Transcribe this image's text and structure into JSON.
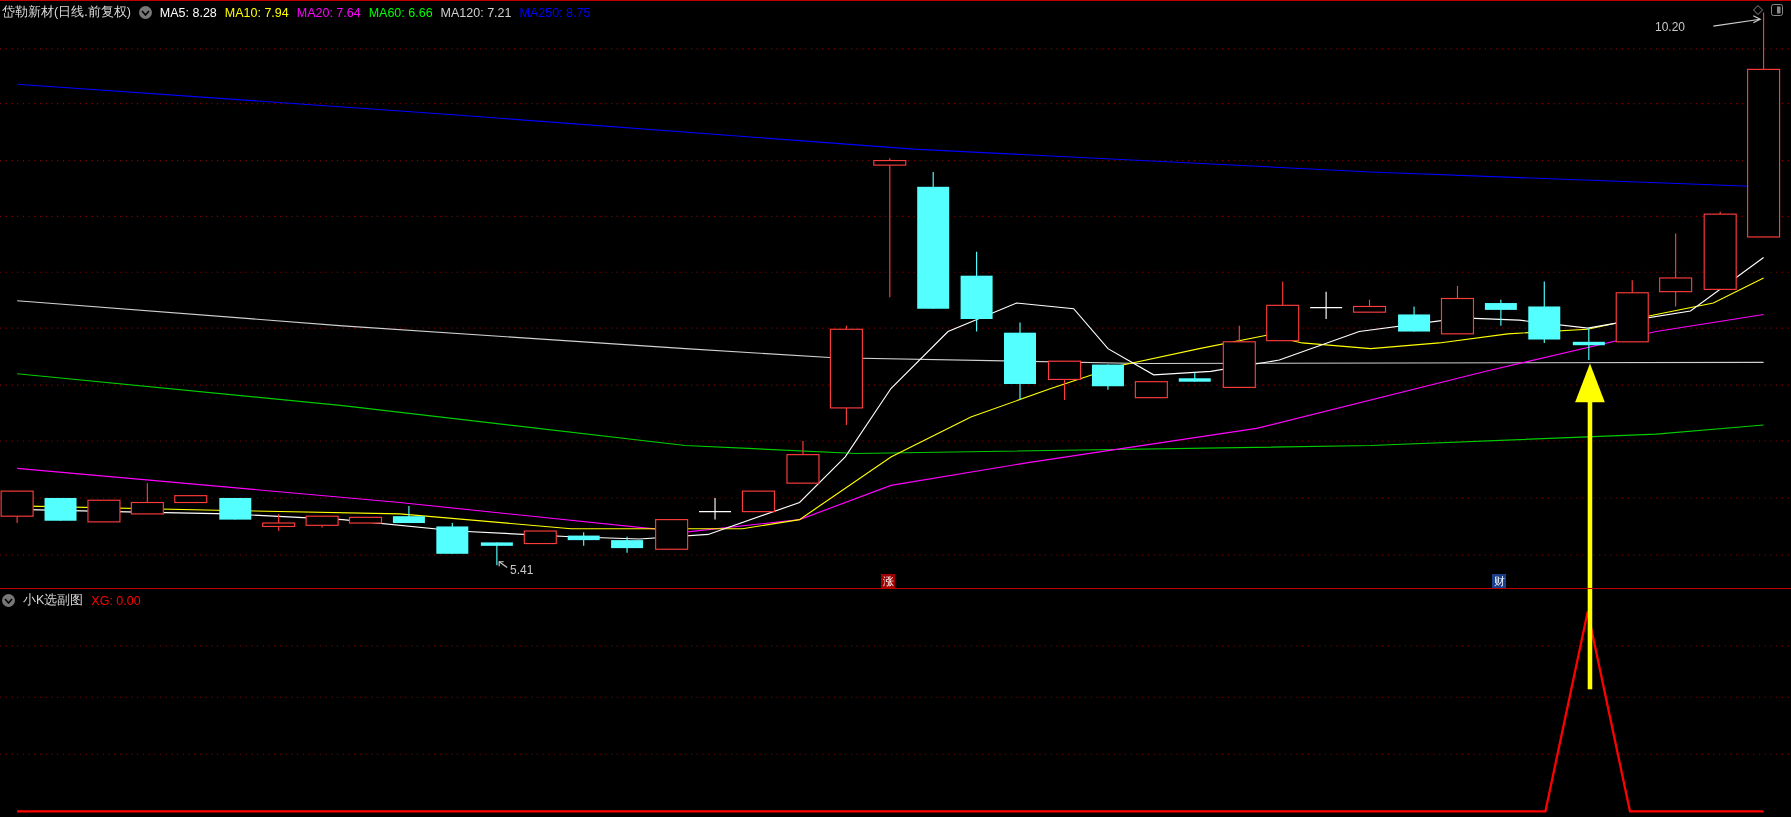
{
  "main_panel": {
    "title": "岱勒新材(日线.前复权)",
    "indicators": [
      {
        "label": "MA5: 8.28",
        "color": "#ffffff"
      },
      {
        "label": "MA10: 7.94",
        "color": "#ffff00"
      },
      {
        "label": "MA20: 7.64",
        "color": "#ff00ff"
      },
      {
        "label": "MA60: 6.66",
        "color": "#00ff00"
      },
      {
        "label": "MA120: 7.21",
        "color": "#d0d0d0"
      },
      {
        "label": "MA250: 8.75",
        "color": "#0000ff"
      }
    ],
    "high_label": "10.20",
    "low_label": "5.41",
    "markers": [
      {
        "text": "涨",
        "color": "#a00000"
      },
      {
        "text": "财",
        "color": "#1a3f8a"
      }
    ]
  },
  "sub_panel": {
    "title": "小K选副图",
    "indicators": [
      {
        "label": "XG: 0.00",
        "color": "#ff0000"
      }
    ]
  }
}
